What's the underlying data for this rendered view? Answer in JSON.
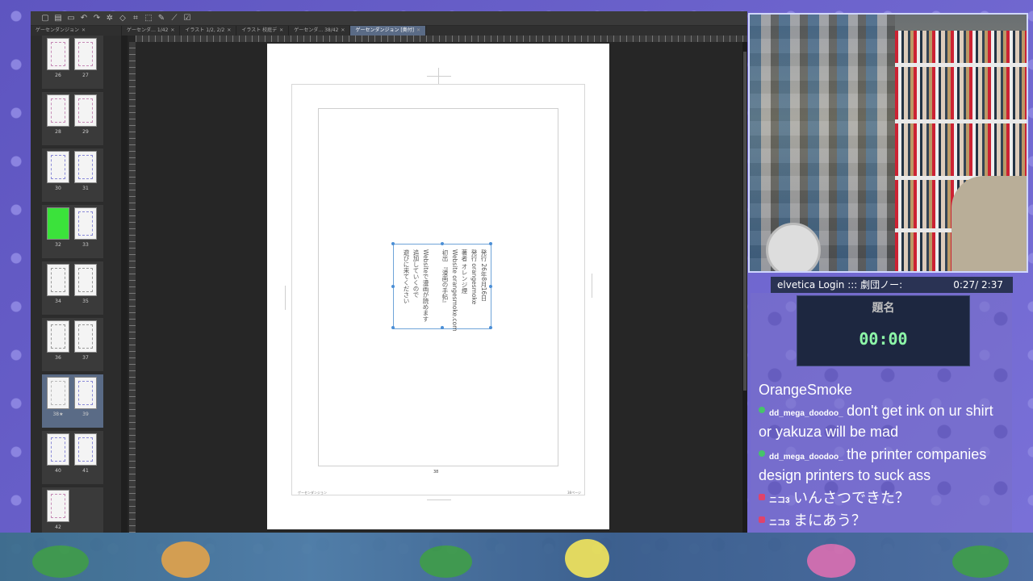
{
  "toolbar": {
    "icons": [
      "new-file-icon",
      "open-icon",
      "save-icon",
      "undo-icon",
      "redo-icon",
      "settings-icon",
      "layer-icon",
      "transform-icon",
      "select-icon",
      "pen-icon",
      "ruler-icon",
      "check-icon"
    ]
  },
  "tabs": [
    {
      "label": "ゲーセンダ… 1/42",
      "active": false
    },
    {
      "label": "イラスト 1/2, 2/2",
      "active": false
    },
    {
      "label": "イラスト 校庭デ",
      "active": false
    },
    {
      "label": "ゲーセンダ… 38/42",
      "active": false
    },
    {
      "label": "ゲーセンダンジョン [奥付]",
      "active": true
    }
  ],
  "pages_panel": {
    "tab_label": "ゲーセンダンジョン",
    "rows": [
      {
        "left": "26",
        "right": "27"
      },
      {
        "left": "28",
        "right": "29"
      },
      {
        "left": "30",
        "right": "31"
      },
      {
        "left": "32",
        "right": "33",
        "left_green": true
      },
      {
        "left": "34",
        "right": "35"
      },
      {
        "left": "36",
        "right": "37"
      },
      {
        "left": "38★",
        "right": "39",
        "selected": true
      },
      {
        "left": "40",
        "right": "41"
      },
      {
        "left": "42",
        "right": ""
      }
    ]
  },
  "document": {
    "colophon_lines": [
      "発行 26年8月16日",
      "発行 orangesmoke",
      "著者 オレンジ煙",
      "Website orangesmoke.com",
      "初出 『漫画の手帖』",
      "",
      "Websiteで漫画が読めます",
      "追加していくので",
      "遊びに来てください"
    ],
    "page_number": "38",
    "footer_left": "ゲーセンダンジョン",
    "footer_right": "38ページ"
  },
  "music": {
    "title": "elvetica Login ::: 劇団ノー:",
    "time": "0:27/ 2:37"
  },
  "timer": {
    "label": "題名",
    "clock": "00:00"
  },
  "chat": {
    "header": "OrangeSmoke",
    "messages": [
      {
        "user": "dd_mega_doodoo_",
        "text": "don't get ink on ur shirt or yakuza will be mad",
        "badge": "green"
      },
      {
        "user": "dd_mega_doodoo_",
        "text": "the printer companies design printers to suck ass",
        "badge": "green"
      },
      {
        "user": "ニコ3",
        "text": "いんさつできた？",
        "badge": "red"
      },
      {
        "user": "ニコ3",
        "text": "まにあう？",
        "badge": "red"
      }
    ]
  }
}
